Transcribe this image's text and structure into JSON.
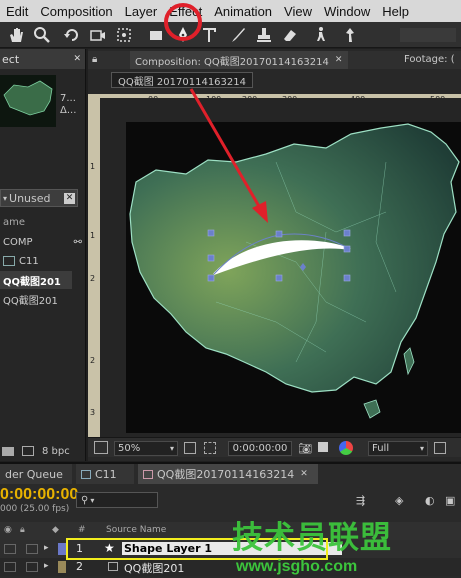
{
  "menu": [
    "Edit",
    "Composition",
    "Layer",
    "Effect",
    "Animation",
    "View",
    "Window",
    "Help"
  ],
  "project": {
    "tab_label": "ect",
    "thumb_info_1": "7...",
    "thumb_info_2": "Δ...",
    "search_value": "Unused",
    "col_name": "ame",
    "items": [
      "COMP",
      "C11",
      "QQ截图201",
      "QQ截图201"
    ],
    "bpc": "8 bpc"
  },
  "composition": {
    "tab_label": "Composition: QQ截图20170114163214",
    "footage_label": "Footage: (",
    "breadcrumb": "QQ截图 20170114163214",
    "ruler_h": [
      "00",
      "100",
      "200",
      "300",
      "400",
      "500"
    ],
    "ruler_v": [
      "1",
      "1",
      "2",
      "2",
      "3"
    ],
    "zoom": "50%",
    "timecode": "0:00:00:00",
    "resolution": "Full"
  },
  "timeline": {
    "render_queue_tab": "der Queue",
    "tab_c11": "C11",
    "tab_comp": "QQ截图20170114163214",
    "timecode": "0:00:00:00",
    "fps": "000 (25.00 fps)",
    "search_placeholder": "",
    "col_number": "#",
    "col_source": "Source Name",
    "layers": [
      {
        "num": "1",
        "name": "Shape Layer 1"
      },
      {
        "num": "2",
        "name": "QQ截图201"
      }
    ],
    "watermark_text": "技术员联盟",
    "watermark_url": "www.jsgho.com"
  },
  "colors": {
    "annotation_red": "#e0202a",
    "highlight_yellow": "#f3ee1e",
    "layer_blue": "#6a78c8",
    "watermark_green": "#3cc43c"
  }
}
